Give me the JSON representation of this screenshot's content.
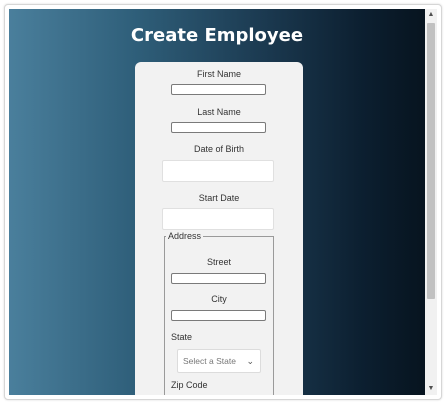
{
  "page": {
    "title": "Create Employee"
  },
  "form": {
    "first_name_label": "First Name",
    "last_name_label": "Last Name",
    "dob_label": "Date of Birth",
    "start_date_label": "Start Date",
    "address": {
      "legend": "Address",
      "street_label": "Street",
      "city_label": "City",
      "state_label": "State",
      "state_select": {
        "selected": "Select a State",
        "icon": "chevron-down-icon"
      },
      "zip_label": "Zip Code"
    }
  },
  "colors": {
    "background_start": "#4a7f9c",
    "background_end": "#07141f",
    "card": "#f2f2f2",
    "title": "#ffffff"
  }
}
